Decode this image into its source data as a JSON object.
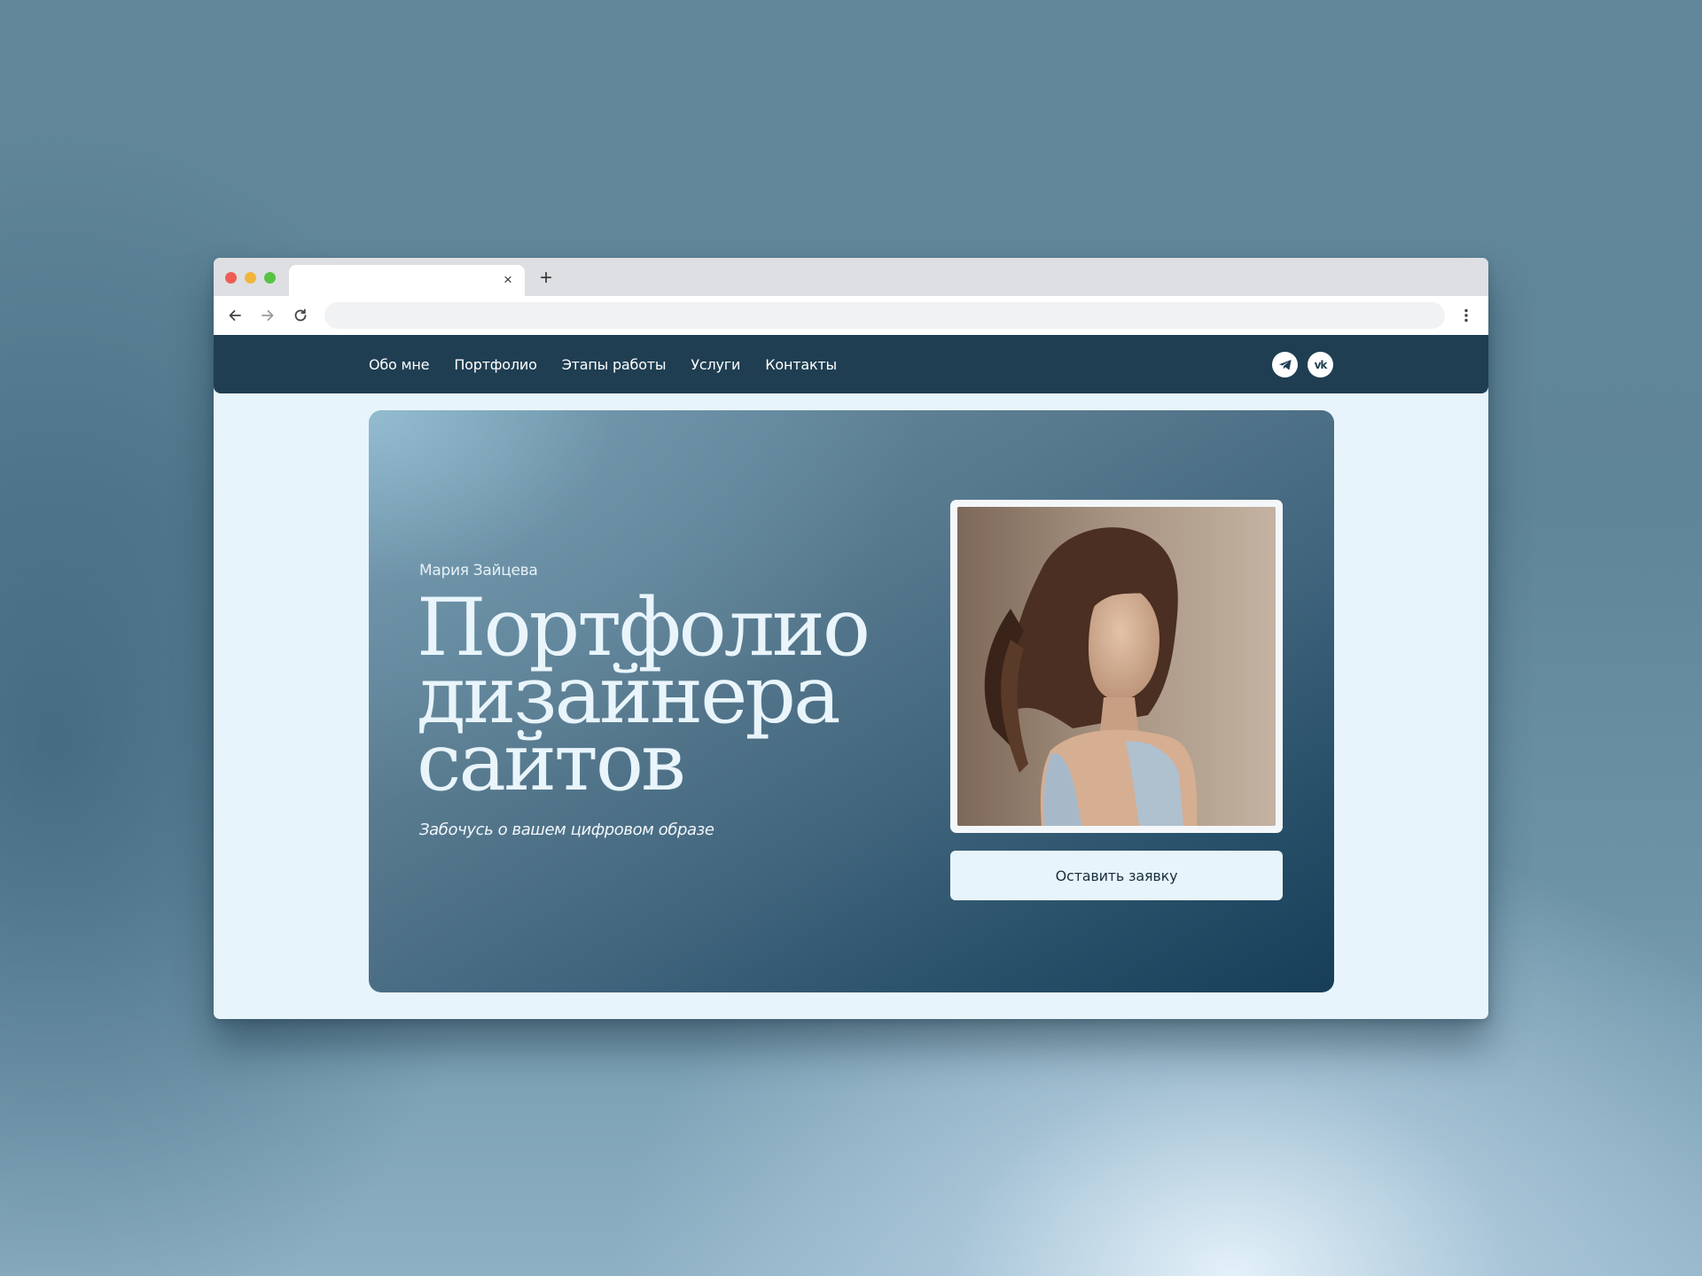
{
  "browser": {
    "tab_close_glyph": "×",
    "new_tab_glyph": "+",
    "address_value": "",
    "icons": [
      "back-arrow-icon",
      "forward-arrow-icon",
      "reload-icon",
      "more-vert-icon"
    ]
  },
  "nav": {
    "items": [
      {
        "label": "Обо мне"
      },
      {
        "label": "Портфолио"
      },
      {
        "label": "Этапы работы"
      },
      {
        "label": "Услуги"
      },
      {
        "label": "Контакты"
      }
    ],
    "social": [
      {
        "icon": "telegram-icon"
      },
      {
        "icon": "vk-icon",
        "glyph": "vk"
      }
    ]
  },
  "hero": {
    "author": "Мария Зайцева",
    "title_lines": [
      "Портфолио",
      "дизайнера",
      "сайтов"
    ],
    "tagline": "Забочусь о вашем цифровом образе",
    "cta_label": "Оставить заявку"
  },
  "colors": {
    "nav_bg": "#1f3e52",
    "page_bg": "#e8f4fb",
    "hero_light": "#8fb4c8",
    "hero_dark": "#173e58",
    "title": "#e9f5fb"
  }
}
